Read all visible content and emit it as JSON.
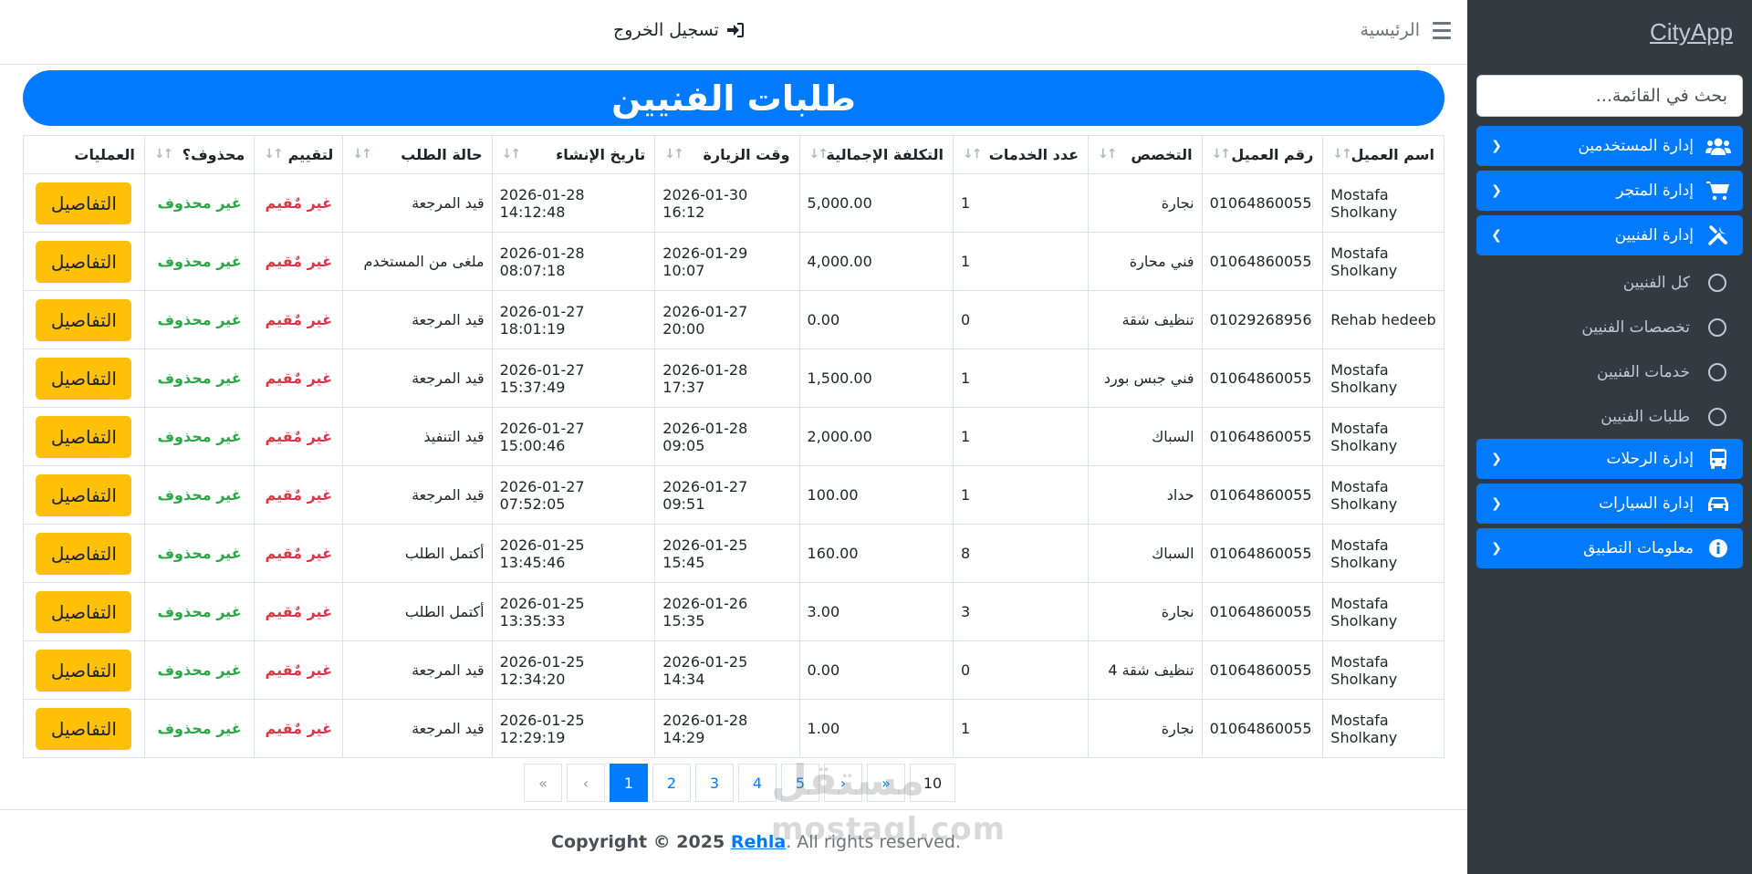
{
  "sidebar": {
    "brand": "CityApp",
    "search_placeholder": "بحث في القائمة...",
    "menu": [
      {
        "label": "إدارة المستخدمين",
        "icon": "users-icon"
      },
      {
        "label": "إدارة المتجر",
        "icon": "cart-icon"
      },
      {
        "label": "إدارة الفنيين",
        "icon": "tools-icon"
      }
    ],
    "submenu": [
      {
        "label": "كل الفنيين"
      },
      {
        "label": "تخصصات الفنيين"
      },
      {
        "label": "خدمات الفنيين"
      },
      {
        "label": "طلبات الفنيين"
      }
    ],
    "menu2": [
      {
        "label": "إدارة الرحلات",
        "icon": "bus-icon"
      },
      {
        "label": "إدارة السيارات",
        "icon": "car-icon"
      },
      {
        "label": "معلومات التطبيق",
        "icon": "info-icon"
      }
    ]
  },
  "topbar": {
    "home": "الرئيسية",
    "logout": "تسجيل الخروج"
  },
  "page": {
    "title": "طلبات الفنيين"
  },
  "table": {
    "headers": [
      "اسم العميل",
      "رقم العميل",
      "التخصص",
      "عدد الخدمات",
      "التكلفة الإجمالية",
      "وقت الزيارة",
      "تاريخ الإنشاء",
      "حالة الطلب",
      "لتقييم",
      "محذوف؟",
      "العمليات"
    ],
    "details_label": "التفاصيل",
    "rows": [
      {
        "name": "Mostafa Sholkany",
        "phone": "01064860055",
        "spec": "نجارة",
        "count": "1",
        "cost": "5,000.00",
        "visit": "2026-01-30 16:12",
        "created": "2026-01-28 14:12:48",
        "status": "قيد المرجعة",
        "rating": "غير مٌقيم",
        "deleted": "غير محذوف"
      },
      {
        "name": "Mostafa Sholkany",
        "phone": "01064860055",
        "spec": "فني محارة",
        "count": "1",
        "cost": "4,000.00",
        "visit": "2026-01-29 10:07",
        "created": "2026-01-28 08:07:18",
        "status": "ملغى من المستخدم",
        "rating": "غير مٌقيم",
        "deleted": "غير محذوف"
      },
      {
        "name": "Rehab hedeeb",
        "phone": "01029268956",
        "spec": "تنظيف شقة",
        "count": "0",
        "cost": "0.00",
        "visit": "2026-01-27 20:00",
        "created": "2026-01-27 18:01:19",
        "status": "قيد المرجعة",
        "rating": "غير مٌقيم",
        "deleted": "غير محذوف"
      },
      {
        "name": "Mostafa Sholkany",
        "phone": "01064860055",
        "spec": "فني جبس بورد",
        "count": "1",
        "cost": "1,500.00",
        "visit": "2026-01-28 17:37",
        "created": "2026-01-27 15:37:49",
        "status": "قيد المرجعة",
        "rating": "غير مٌقيم",
        "deleted": "غير محذوف"
      },
      {
        "name": "Mostafa Sholkany",
        "phone": "01064860055",
        "spec": "السباك",
        "count": "1",
        "cost": "2,000.00",
        "visit": "2026-01-28 09:05",
        "created": "2026-01-27 15:00:46",
        "status": "قيد التنفيذ",
        "rating": "غير مٌقيم",
        "deleted": "غير محذوف"
      },
      {
        "name": "Mostafa Sholkany",
        "phone": "01064860055",
        "spec": "حداد",
        "count": "1",
        "cost": "100.00",
        "visit": "2026-01-27 09:51",
        "created": "2026-01-27 07:52:05",
        "status": "قيد المرجعة",
        "rating": "غير مٌقيم",
        "deleted": "غير محذوف"
      },
      {
        "name": "Mostafa Sholkany",
        "phone": "01064860055",
        "spec": "السباك",
        "count": "8",
        "cost": "160.00",
        "visit": "2026-01-25 15:45",
        "created": "2026-01-25 13:45:46",
        "status": "أكتمل الطلب",
        "rating": "غير مٌقيم",
        "deleted": "غير محذوف"
      },
      {
        "name": "Mostafa Sholkany",
        "phone": "01064860055",
        "spec": "نجارة",
        "count": "3",
        "cost": "3.00",
        "visit": "2026-01-26 15:35",
        "created": "2026-01-25 13:35:33",
        "status": "أكتمل الطلب",
        "rating": "غير مٌقيم",
        "deleted": "غير محذوف"
      },
      {
        "name": "Mostafa Sholkany",
        "phone": "01064860055",
        "spec": "تنظيف شقة 4",
        "count": "0",
        "cost": "0.00",
        "visit": "2026-01-25 14:34",
        "created": "2026-01-25 12:34:20",
        "status": "قيد المرجعة",
        "rating": "غير مٌقيم",
        "deleted": "غير محذوف"
      },
      {
        "name": "Mostafa Sholkany",
        "phone": "01064860055",
        "spec": "نجارة",
        "count": "1",
        "cost": "1.00",
        "visit": "2026-01-28 14:29",
        "created": "2026-01-25 12:29:19",
        "status": "قيد المرجعة",
        "rating": "غير مٌقيم",
        "deleted": "غير محذوف"
      }
    ]
  },
  "pagination": {
    "first": "«",
    "prev": "‹",
    "pages": [
      "1",
      "2",
      "3",
      "4",
      "5"
    ],
    "next": "›",
    "last": "»",
    "per_page": "10"
  },
  "footer": {
    "prefix": "Copyright © 2025 ",
    "brand": "Rehla",
    "suffix": ". All rights reserved."
  },
  "watermark": {
    "line1": "مستقل",
    "line2": "mostaql.com"
  },
  "colors": {
    "primary": "#007bff",
    "sidebar_bg": "#343a40",
    "warning": "#ffc107",
    "danger": "#dc3545",
    "success": "#28a745"
  }
}
